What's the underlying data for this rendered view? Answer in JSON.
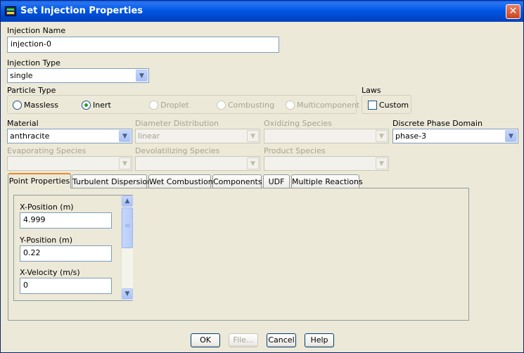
{
  "window": {
    "title": "Set Injection Properties",
    "close_glyph": "✕"
  },
  "injection_name": {
    "label": "Injection Name",
    "value": "injection-0"
  },
  "injection_type": {
    "label": "Injection Type",
    "value": "single"
  },
  "particle_type": {
    "label": "Particle Type",
    "options": [
      "Massless",
      "Inert",
      "Droplet",
      "Combusting",
      "Multicomponent"
    ],
    "selected": "Inert"
  },
  "laws": {
    "label": "Laws",
    "custom_label": "Custom",
    "custom_checked": false
  },
  "material": {
    "label": "Material",
    "value": "anthracite"
  },
  "diameter_distribution": {
    "label": "Diameter Distribution",
    "value": "linear"
  },
  "oxidizing_species": {
    "label": "Oxidizing Species",
    "value": ""
  },
  "discrete_phase_domain": {
    "label": "Discrete Phase Domain",
    "value": "phase-3"
  },
  "evaporating_species": {
    "label": "Evaporating Species",
    "value": ""
  },
  "devolatilizing_species": {
    "label": "Devolatilizing Species",
    "value": ""
  },
  "product_species": {
    "label": "Product Species",
    "value": ""
  },
  "tabs": [
    "Point Properties",
    "Turbulent Dispersion",
    "Wet Combustion",
    "Components",
    "UDF",
    "Multiple Reactions"
  ],
  "active_tab": "Point Properties",
  "point_properties": {
    "x_position": {
      "label": "X-Position (m)",
      "value": "4.999"
    },
    "y_position": {
      "label": "Y-Position (m)",
      "value": "0.22"
    },
    "x_velocity": {
      "label": "X-Velocity (m/s)",
      "value": "0"
    }
  },
  "buttons": {
    "ok": "OK",
    "file": "File...",
    "cancel": "Cancel",
    "help": "Help"
  },
  "colors": {
    "title_bar": "#0058e6",
    "dialog_bg": "#ece9d8",
    "active_tab_accent": "#e68b2c",
    "radio_dot": "#21a121"
  }
}
